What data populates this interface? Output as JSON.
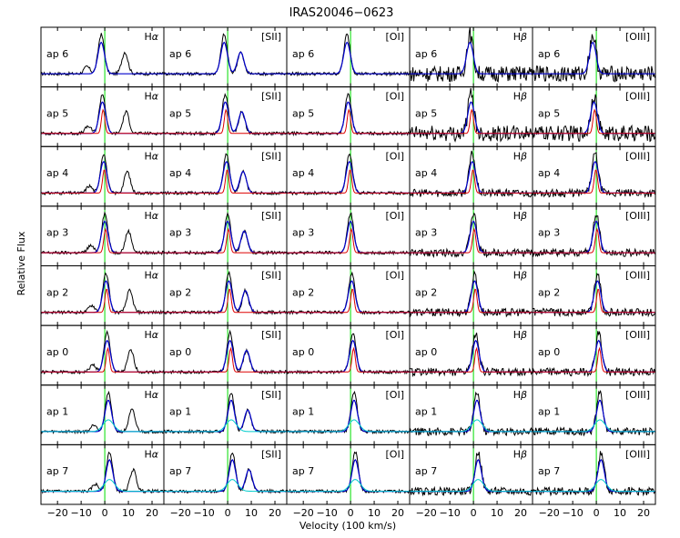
{
  "chart_data": {
    "type": "line",
    "title": "IRAS20046−0623",
    "xlabel": "Velocity (100 km/s)",
    "ylabel": "Relative Flux",
    "xlim": [
      -27,
      25
    ],
    "x_ticks": [
      "−20",
      "−10",
      "0",
      "10",
      "20"
    ],
    "x_tick_values": [
      -20,
      -10,
      0,
      10,
      20
    ],
    "grid": false,
    "legend": "none",
    "reference_line": {
      "x": 0,
      "color": "#00dd00"
    },
    "columns": [
      {
        "line": "Hα",
        "label_parts": [
          "H",
          "α"
        ],
        "lines_at": [
          -6,
          0,
          10
        ]
      },
      {
        "line": "[SII]",
        "label_parts": [
          "[SII]"
        ],
        "lines_at": [
          0,
          7
        ]
      },
      {
        "line": "[OI]",
        "label_parts": [
          "[OI]"
        ],
        "lines_at": [
          0
        ]
      },
      {
        "line": "Hβ",
        "label_parts": [
          "H",
          "β"
        ],
        "lines_at": [
          0
        ]
      },
      {
        "line": "[OIII]",
        "label_parts": [
          "[OIII]"
        ],
        "lines_at": [
          0
        ]
      }
    ],
    "apertures": [
      "ap 6",
      "ap 5",
      "ap 4",
      "ap 3",
      "ap 2",
      "ap 0",
      "ap 1",
      "ap 7"
    ],
    "component_colors": {
      "data": "#000000",
      "total_fit": "#0000cc",
      "narrow": "#dd0000",
      "broad": "#00cccc",
      "residual": "#008800"
    },
    "series": [
      {
        "aperture": "ap 6",
        "line": "Hα",
        "peak_velocity": -1.5,
        "peak_flux": 1.0
      },
      {
        "aperture": "ap 5",
        "line": "Hα",
        "peak_velocity": -1.0,
        "peak_flux": 1.0
      },
      {
        "aperture": "ap 4",
        "line": "Hα",
        "peak_velocity": -0.5,
        "peak_flux": 1.0
      },
      {
        "aperture": "ap 3",
        "line": "Hα",
        "peak_velocity": 0.0,
        "peak_flux": 1.0
      },
      {
        "aperture": "ap 2",
        "line": "Hα",
        "peak_velocity": 0.5,
        "peak_flux": 1.0
      },
      {
        "aperture": "ap 0",
        "line": "Hα",
        "peak_velocity": 1.0,
        "peak_flux": 1.0
      },
      {
        "aperture": "ap 1",
        "line": "Hα",
        "peak_velocity": 1.0,
        "peak_flux": 1.0
      },
      {
        "aperture": "ap 7",
        "line": "Hα",
        "peak_velocity": 1.0,
        "peak_flux": 1.0
      }
    ]
  }
}
